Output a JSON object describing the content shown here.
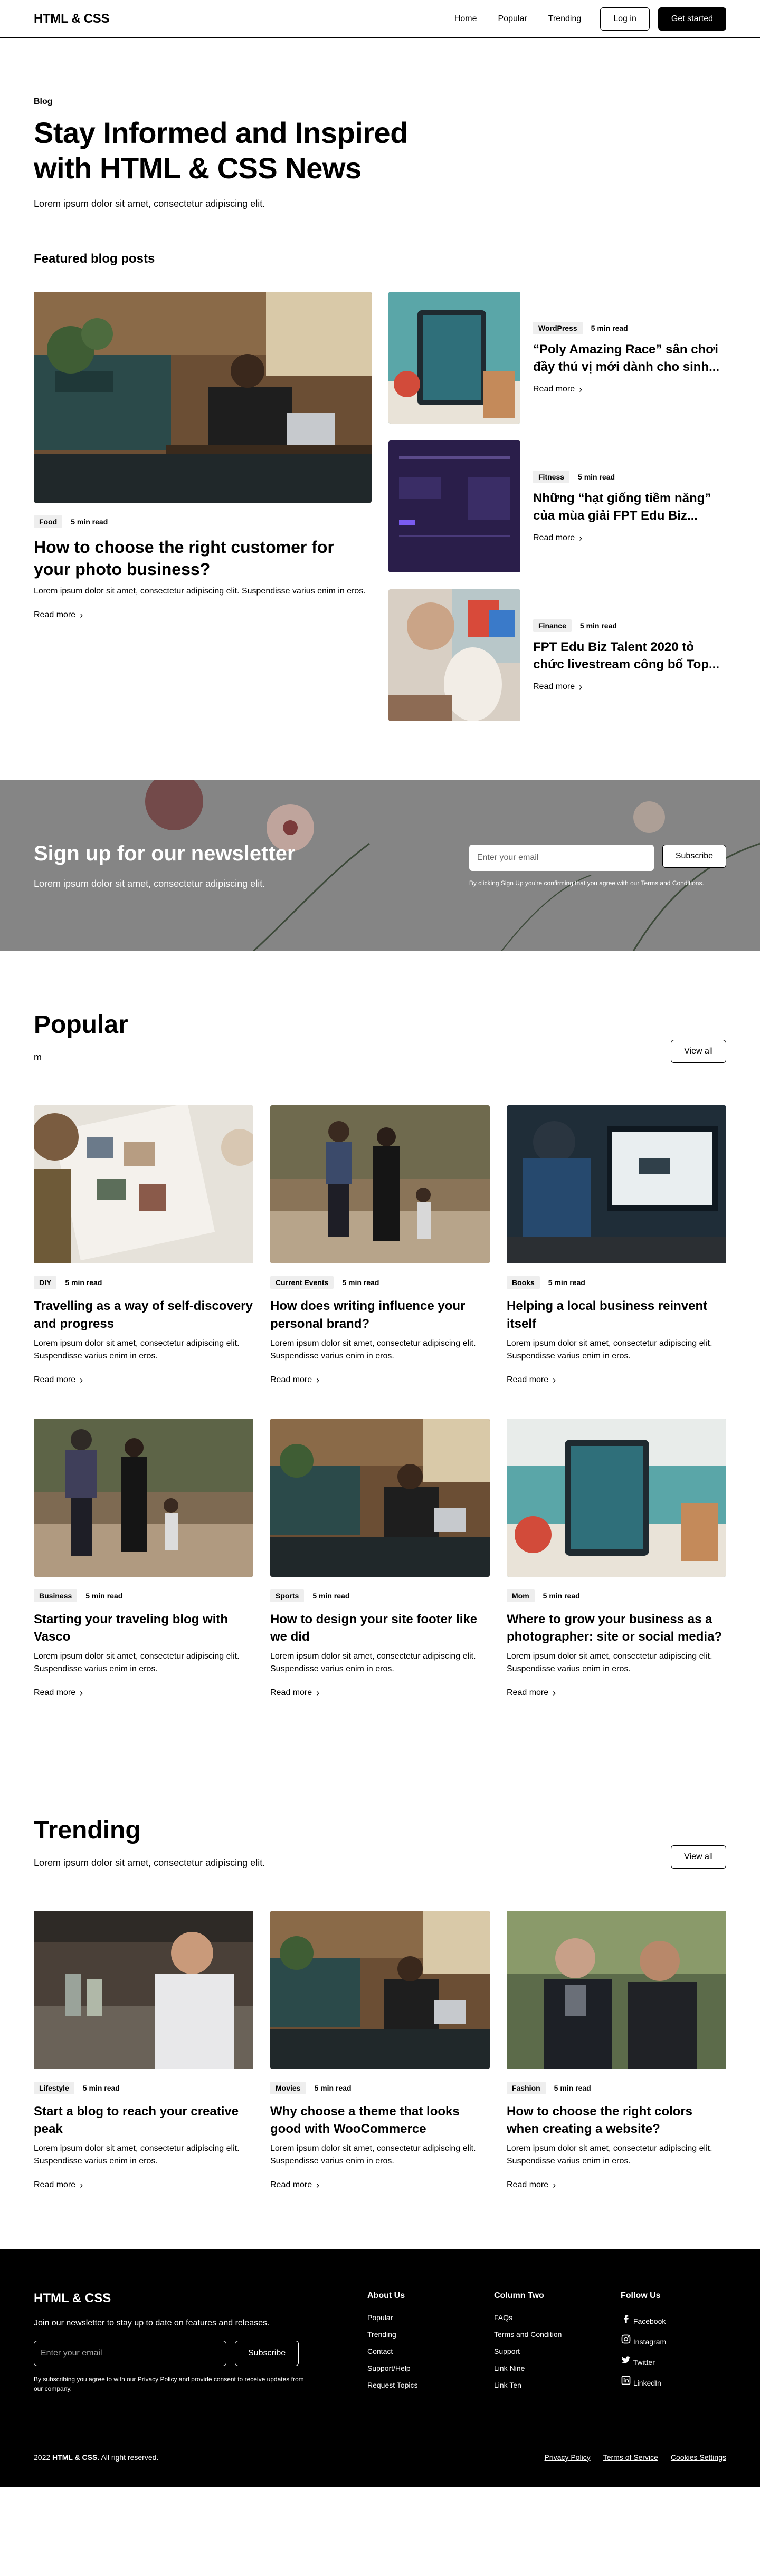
{
  "nav": {
    "brand": "HTML & CSS",
    "links": [
      "Home",
      "Popular",
      "Trending"
    ],
    "login": "Log in",
    "cta": "Get started"
  },
  "hero": {
    "eyebrow": "Blog",
    "title": "Stay Informed and Inspired with HTML & CSS News",
    "subtitle": "Lorem ipsum dolor sit amet, consectetur adipiscing elit."
  },
  "featured": {
    "heading": "Featured blog posts",
    "main": {
      "tag": "Food",
      "read_time": "5 min read",
      "title": "How to choose the right customer for your photo business?",
      "desc": "Lorem ipsum dolor sit amet, consectetur adipiscing elit. Suspendisse varius enim in eros.",
      "read_more": "Read more"
    },
    "side": [
      {
        "tag": "WordPress",
        "read_time": "5 min read",
        "title": "“Poly Amazing Race” sân chơi đầy thú vị mới dành cho sinh...",
        "read_more": "Read more"
      },
      {
        "tag": "Fitness",
        "read_time": "5 min read",
        "title": "Những “hạt giống tiềm năng” của mùa giải FPT Edu Biz...",
        "read_more": "Read more"
      },
      {
        "tag": "Finance",
        "read_time": "5 min read",
        "title": "FPT Edu Biz Talent 2020 tỏ chức livestream công bố Top...",
        "read_more": "Read more"
      }
    ]
  },
  "newsletter": {
    "title": "Sign up for our newsletter",
    "subtitle": "Lorem ipsum dolor sit amet, consectetur adipiscing elit.",
    "placeholder": "Enter your email",
    "button": "Subscribe",
    "note_prefix": "By clicking Sign Up you're confirming that you agree with our",
    "note_link": "Terms and Conditions."
  },
  "popular": {
    "title": "Popular",
    "subtitle": "m",
    "view_all": "View all",
    "cards": [
      {
        "tag": "DIY",
        "read_time": "5 min read",
        "title": "Travelling as a way of self-discovery and progress",
        "desc": "Lorem ipsum dolor sit amet, consectetur adipiscing elit. Suspendisse varius enim in eros.",
        "read_more": "Read more"
      },
      {
        "tag": "Current Events",
        "read_time": "5 min read",
        "title": "How does writing influence your personal brand?",
        "desc": "Lorem ipsum dolor sit amet, consectetur adipiscing elit. Suspendisse varius enim in eros.",
        "read_more": "Read more"
      },
      {
        "tag": "Books",
        "read_time": "5 min read",
        "title": "Helping a local business reinvent itself",
        "desc": "Lorem ipsum dolor sit amet, consectetur adipiscing elit. Suspendisse varius enim in eros.",
        "read_more": "Read more"
      },
      {
        "tag": "Business",
        "read_time": "5 min read",
        "title": "Starting your traveling blog with Vasco",
        "desc": "Lorem ipsum dolor sit amet, consectetur adipiscing elit. Suspendisse varius enim in eros.",
        "read_more": "Read more"
      },
      {
        "tag": "Sports",
        "read_time": "5 min read",
        "title": "How to design your site footer like we did",
        "desc": "Lorem ipsum dolor sit amet, consectetur adipiscing elit. Suspendisse varius enim in eros.",
        "read_more": "Read more"
      },
      {
        "tag": "Mom",
        "read_time": "5 min read",
        "title": "Where to grow your business as a photographer: site or social media?",
        "desc": "Lorem ipsum dolor sit amet, consectetur adipiscing elit. Suspendisse varius enim in eros.",
        "read_more": "Read more"
      }
    ]
  },
  "trending": {
    "title": "Trending",
    "subtitle": "Lorem ipsum dolor sit amet, consectetur adipiscing elit.",
    "view_all": "View all",
    "cards": [
      {
        "tag": "Lifestyle",
        "read_time": "5 min read",
        "title": "Start a blog to reach your creative peak",
        "desc": "Lorem ipsum dolor sit amet, consectetur adipiscing elit. Suspendisse varius enim in eros.",
        "read_more": "Read more"
      },
      {
        "tag": "Movies",
        "read_time": "5 min read",
        "title": "Why choose a theme that looks good with WooCommerce",
        "desc": "Lorem ipsum dolor sit amet, consectetur adipiscing elit. Suspendisse varius enim in eros.",
        "read_more": "Read more"
      },
      {
        "tag": "Fashion",
        "read_time": "5 min read",
        "title": "How to choose the right colors when creating a website?",
        "desc": "Lorem ipsum dolor sit amet, consectetur adipiscing elit. Suspendisse varius enim in eros.",
        "read_more": "Read more"
      }
    ]
  },
  "footer": {
    "brand": "HTML & CSS",
    "tagline": "Join our newsletter to stay up to date on features and releases.",
    "placeholder": "Enter your email",
    "button": "Subscribe",
    "note_prefix": "By subscribing you agree to with our",
    "note_link": "Privacy Policy",
    "note_suffix": "and provide consent to receive updates from our company.",
    "col1": {
      "title": "About Us",
      "links": [
        "Popular",
        "Trending",
        "Contact",
        "Support/Help",
        "Request Topics"
      ]
    },
    "col2": {
      "title": "Column Two",
      "links": [
        "FAQs",
        "Terms and Condition",
        "Support",
        "Link Nine",
        "Link Ten"
      ]
    },
    "col3": {
      "title": "Follow Us",
      "links": [
        "Facebook",
        "Instagram",
        "Twitter",
        "LinkedIn"
      ]
    },
    "copyright_prefix": "2022",
    "copyright_brand": "HTML & CSS.",
    "copyright_suffix": "All right reserved.",
    "bottom_links": [
      "Privacy Policy",
      "Terms of Service",
      "Cookies Settings"
    ]
  },
  "icons": {
    "chevron": "chevron-right-icon",
    "social": [
      "facebook-icon",
      "instagram-icon",
      "twitter-icon",
      "linkedin-icon"
    ]
  }
}
